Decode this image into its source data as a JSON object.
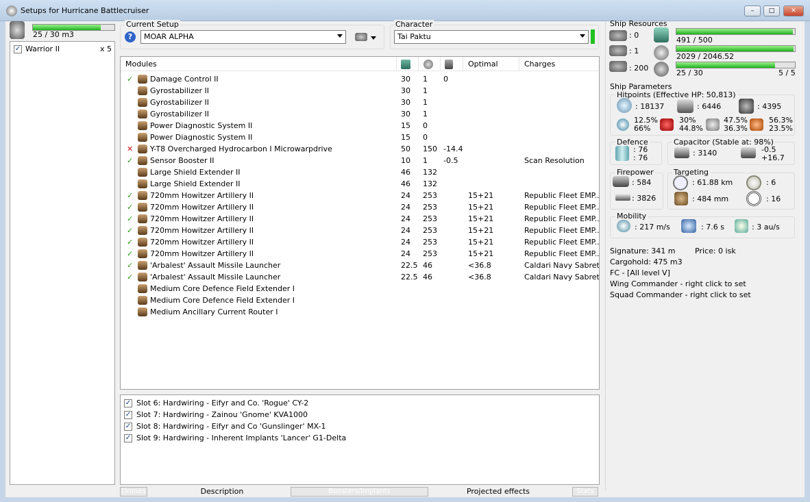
{
  "window": {
    "title": "Setups for Hurricane Battlecruiser",
    "min": "–",
    "max": "□",
    "close": "✕"
  },
  "drones": {
    "capacity": "25 / 30 m3",
    "capacity_fill": 0.83,
    "items": [
      {
        "name": "Warrior II",
        "qty": "x 5",
        "checked": true
      }
    ]
  },
  "setup": {
    "label": "Current Setup",
    "value": "MOAR ALPHA"
  },
  "character": {
    "label": "Character",
    "value": "Tai Paktu"
  },
  "modules": {
    "headers": {
      "name": "Modules",
      "optimal": "Optimal",
      "charges": "Charges"
    },
    "rows": [
      {
        "status": "ok",
        "name": "Damage Control II",
        "c1": "30",
        "c2": "1",
        "c3": "0",
        "optimal": "",
        "charges": ""
      },
      {
        "status": "",
        "name": "Gyrostabilizer II",
        "c1": "30",
        "c2": "1",
        "c3": "",
        "optimal": "",
        "charges": ""
      },
      {
        "status": "",
        "name": "Gyrostabilizer II",
        "c1": "30",
        "c2": "1",
        "c3": "",
        "optimal": "",
        "charges": ""
      },
      {
        "status": "",
        "name": "Gyrostabilizer II",
        "c1": "30",
        "c2": "1",
        "c3": "",
        "optimal": "",
        "charges": ""
      },
      {
        "status": "",
        "name": "Power Diagnostic System II",
        "c1": "15",
        "c2": "0",
        "c3": "",
        "optimal": "",
        "charges": ""
      },
      {
        "status": "",
        "name": "Power Diagnostic System II",
        "c1": "15",
        "c2": "0",
        "c3": "",
        "optimal": "",
        "charges": ""
      },
      {
        "status": "off",
        "name": "Y-T8 Overcharged Hydrocarbon I Microwarpdrive",
        "c1": "50",
        "c2": "150",
        "c3": "-14.4",
        "optimal": "",
        "charges": ""
      },
      {
        "status": "ok",
        "name": "Sensor Booster II",
        "c1": "10",
        "c2": "1",
        "c3": "-0.5",
        "optimal": "",
        "charges": "Scan Resolution"
      },
      {
        "status": "",
        "name": "Large Shield Extender II",
        "c1": "46",
        "c2": "132",
        "c3": "",
        "optimal": "",
        "charges": ""
      },
      {
        "status": "",
        "name": "Large Shield Extender II",
        "c1": "46",
        "c2": "132",
        "c3": "",
        "optimal": "",
        "charges": ""
      },
      {
        "status": "ok",
        "name": "720mm Howitzer Artillery II",
        "c1": "24",
        "c2": "253",
        "c3": "",
        "optimal": "15+21",
        "charges": "Republic Fleet EMP..."
      },
      {
        "status": "ok",
        "name": "720mm Howitzer Artillery II",
        "c1": "24",
        "c2": "253",
        "c3": "",
        "optimal": "15+21",
        "charges": "Republic Fleet EMP..."
      },
      {
        "status": "ok",
        "name": "720mm Howitzer Artillery II",
        "c1": "24",
        "c2": "253",
        "c3": "",
        "optimal": "15+21",
        "charges": "Republic Fleet EMP..."
      },
      {
        "status": "ok",
        "name": "720mm Howitzer Artillery II",
        "c1": "24",
        "c2": "253",
        "c3": "",
        "optimal": "15+21",
        "charges": "Republic Fleet EMP..."
      },
      {
        "status": "ok",
        "name": "720mm Howitzer Artillery II",
        "c1": "24",
        "c2": "253",
        "c3": "",
        "optimal": "15+21",
        "charges": "Republic Fleet EMP..."
      },
      {
        "status": "ok",
        "name": "720mm Howitzer Artillery II",
        "c1": "24",
        "c2": "253",
        "c3": "",
        "optimal": "15+21",
        "charges": "Republic Fleet EMP..."
      },
      {
        "status": "ok",
        "name": "'Arbalest' Assault Missile Launcher",
        "c1": "22.5",
        "c2": "46",
        "c3": "",
        "optimal": "<36.8",
        "charges": "Caldari Navy Sabret..."
      },
      {
        "status": "ok",
        "name": "'Arbalest' Assault Missile Launcher",
        "c1": "22.5",
        "c2": "46",
        "c3": "",
        "optimal": "<36.8",
        "charges": "Caldari Navy Sabret..."
      },
      {
        "status": "",
        "name": "Medium Core Defence Field Extender I",
        "c1": "",
        "c2": "",
        "c3": "",
        "optimal": "",
        "charges": ""
      },
      {
        "status": "",
        "name": "Medium Core Defence Field Extender I",
        "c1": "",
        "c2": "",
        "c3": "",
        "optimal": "",
        "charges": ""
      },
      {
        "status": "",
        "name": "Medium Ancillary Current Router I",
        "c1": "",
        "c2": "",
        "c3": "",
        "optimal": "",
        "charges": ""
      }
    ]
  },
  "implants": [
    {
      "label": "Slot 6: Hardwiring - Eifyr and Co. 'Rogue' CY-2",
      "checked": true
    },
    {
      "label": "Slot 7: Hardwiring - Zainou 'Gnome' KVA1000",
      "checked": true
    },
    {
      "label": "Slot 8: Hardwiring - Eifyr and Co 'Gunslinger' MX-1",
      "checked": true
    },
    {
      "label": "Slot 9: Hardwiring - Inherent Implants 'Lancer' G1-Delta",
      "checked": true
    }
  ],
  "tabs": {
    "drones": "Drones",
    "description": "Description",
    "boosters": "Boosters/Implants",
    "projected": "Projected effects",
    "stats": "Stats"
  },
  "resources": {
    "title": "Ship Resources",
    "turrets": ": 0",
    "launchers": ": 1",
    "calibration": ": 200",
    "cpu": "491 / 500",
    "cpu_fill": 0.98,
    "power": "2029 / 2046.52",
    "power_fill": 0.99,
    "drone_bw": "25 / 30",
    "drone_bw_fill": 0.83,
    "drones_active": "5 / 5"
  },
  "params": {
    "title": "Ship Parameters",
    "hp_title": "Hitpoints (Effective HP: 50,813)",
    "shield": ": 18137",
    "armor": ": 6446",
    "structure": ": 4395",
    "res": [
      {
        "a": "12.5%",
        "b": "66%"
      },
      {
        "a": "30%",
        "b": "44.8%"
      },
      {
        "a": "47.5%",
        "b": "36.3%"
      },
      {
        "a": "56.3%",
        "b": "23.5%"
      }
    ],
    "defence_title": "Defence",
    "def_a": ": 76",
    "def_b": ": 76",
    "cap_title": "Capacitor (Stable at: 98%)",
    "cap_amount": ": 3140",
    "cap_a": "-0.5",
    "cap_b": "+16.7",
    "fire_title": "Firepower",
    "dps": ": 584",
    "volley": ": 3826",
    "tgt_title": "Targeting",
    "range": ": 61.88 km",
    "targets": ": 6",
    "scanres": ": 484 mm",
    "sensor": ": 16",
    "mob_title": "Mobility",
    "speed": ": 217 m/s",
    "align": ": 7.6 s",
    "warp": ": 3 au/s",
    "signature": "Signature: 341 m",
    "price": "Price: 0 isk",
    "cargo": "Cargohold: 475 m3",
    "fc": "FC - [All level V]",
    "wing": "Wing Commander - right click to set",
    "squad": "Squad Commander - right click to set"
  }
}
